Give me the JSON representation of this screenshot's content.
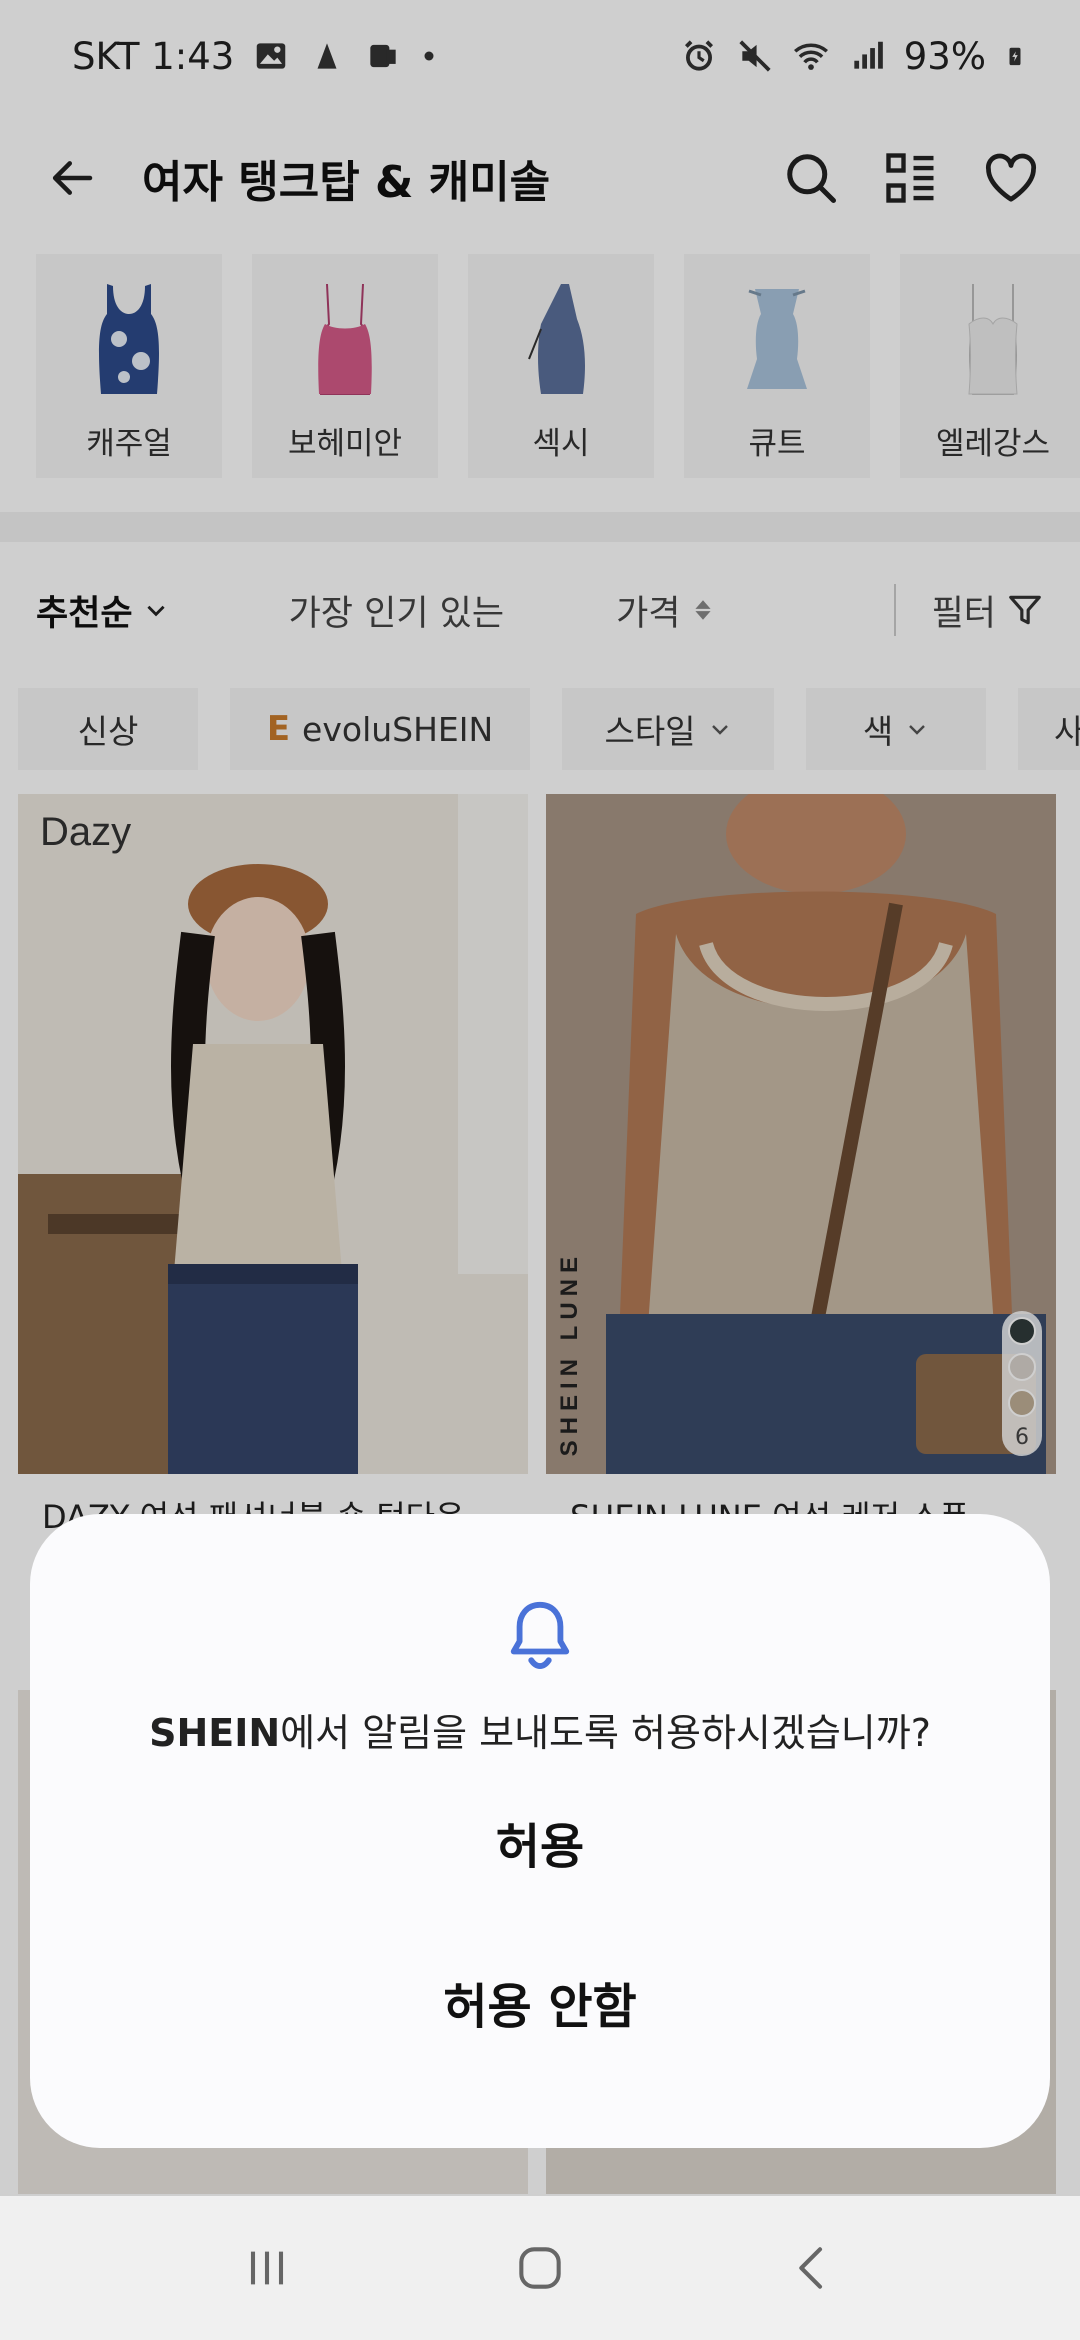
{
  "status_bar": {
    "carrier_time": "SKT 1:43",
    "battery": "93%"
  },
  "header": {
    "title": "여자 탱크탑 & 캐미솔",
    "icons": [
      "back-arrow-icon",
      "search-icon",
      "grid-view-icon",
      "heart-icon"
    ]
  },
  "categories": [
    {
      "label": "캐주얼",
      "color": "#2d4a8a"
    },
    {
      "label": "보헤미안",
      "color": "#d45a88"
    },
    {
      "label": "섹시",
      "color": "#5b6f9a"
    },
    {
      "label": "큐트",
      "color": "#a9c3dc"
    },
    {
      "label": "엘레강스",
      "color": "#ececec"
    }
  ],
  "sort_bar": {
    "recommended": "추천순",
    "popular": "가장 인기 있는",
    "price": "가격",
    "filter": "필터"
  },
  "filter_chips": {
    "new": "신상",
    "evolu_mark": "E",
    "evolu": "evoluSHEIN",
    "style": "스타일",
    "color": "색",
    "partial": "사"
  },
  "products": [
    {
      "brand_mark": "Dazy",
      "title": "DAZY 여성 패셔너블 숏 턴다운",
      "bg": "#e7e1d6"
    },
    {
      "brand_vertical": "SHEIN LUNE",
      "title": "SHEIN LUNE 여성 레저 스푼",
      "swatch_count": "6",
      "swatch_colors": [
        "#2f3b3a",
        "#d8d2cc",
        "#bfae95"
      ],
      "bg": "#b29b88"
    }
  ],
  "dialog": {
    "app_name": "SHEIN",
    "message": "에서 알림을 보내도록 허용하시겠습니까?",
    "allow": "허용",
    "deny": "허용 안함",
    "accent": "#4a72d8"
  },
  "nav_bar": {
    "icons": [
      "recent-apps-icon",
      "home-icon",
      "back-icon"
    ]
  }
}
